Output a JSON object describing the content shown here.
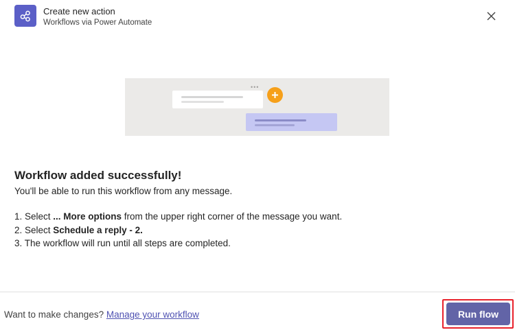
{
  "header": {
    "title": "Create new action",
    "subtitle": "Workflows via Power Automate",
    "app_icon": "workflow-share-icon",
    "close_icon": "close-icon"
  },
  "illustration": {
    "dots": "•••",
    "plus_icon": "plus-icon"
  },
  "content": {
    "title": "Workflow added successfully!",
    "description": "You'll be able to run this workflow from any message.",
    "steps": [
      {
        "prefix": "1. Select ",
        "bold": "... More options",
        "suffix": " from the upper right corner of the message you want."
      },
      {
        "prefix": "2. Select ",
        "bold": "Schedule a reply - 2.",
        "suffix": ""
      },
      {
        "prefix": "3. The workflow will run until all steps are completed.",
        "bold": "",
        "suffix": ""
      }
    ]
  },
  "footer": {
    "prompt": "Want to make changes?",
    "link_label": "Manage your workflow",
    "run_button_label": "Run flow"
  },
  "colors": {
    "accent": "#6264a7",
    "app_icon_bg": "#5b5fc7",
    "link": "#4f52b2",
    "highlight": "#e8202a",
    "plus_badge": "#f6a01a"
  }
}
